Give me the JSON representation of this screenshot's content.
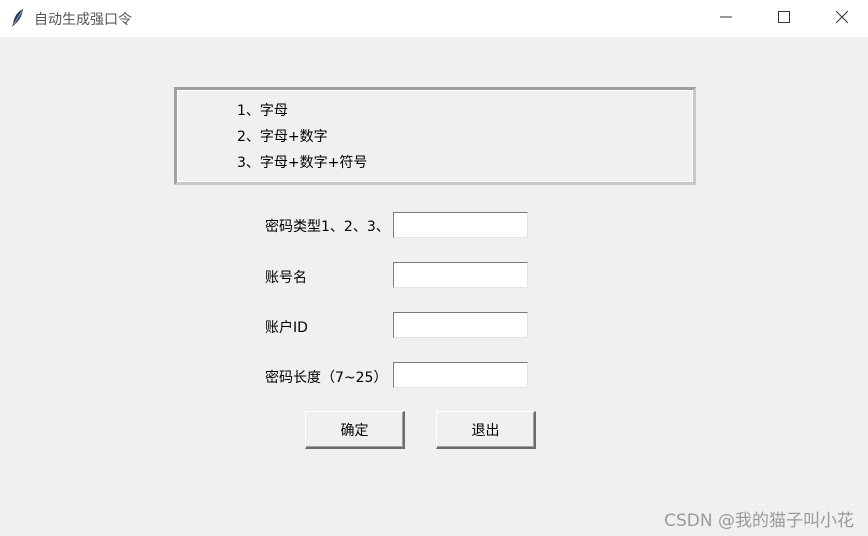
{
  "window": {
    "title": "自动生成强口令",
    "app_icon": "feather-icon",
    "controls": {
      "minimize_icon": "minimize-icon",
      "maximize_icon": "maximize-icon",
      "close_icon": "close-icon"
    }
  },
  "info_box": {
    "lines": [
      "1、字母",
      "2、字母+数字",
      "3、字母+数字+符号"
    ]
  },
  "form": {
    "password_type": {
      "label": "密码类型1、2、3、",
      "value": ""
    },
    "account_name": {
      "label": "账号名",
      "value": ""
    },
    "account_id": {
      "label": "账户ID",
      "value": ""
    },
    "password_length": {
      "label": "密码长度（7~25）",
      "value": ""
    }
  },
  "buttons": {
    "confirm_label": "确定",
    "quit_label": "退出"
  },
  "watermark": "CSDN @我的猫子叫小花",
  "colors": {
    "window_bg": "#f0f0f0",
    "titlebar_bg": "#ffffff",
    "input_bg": "#ffffff"
  }
}
